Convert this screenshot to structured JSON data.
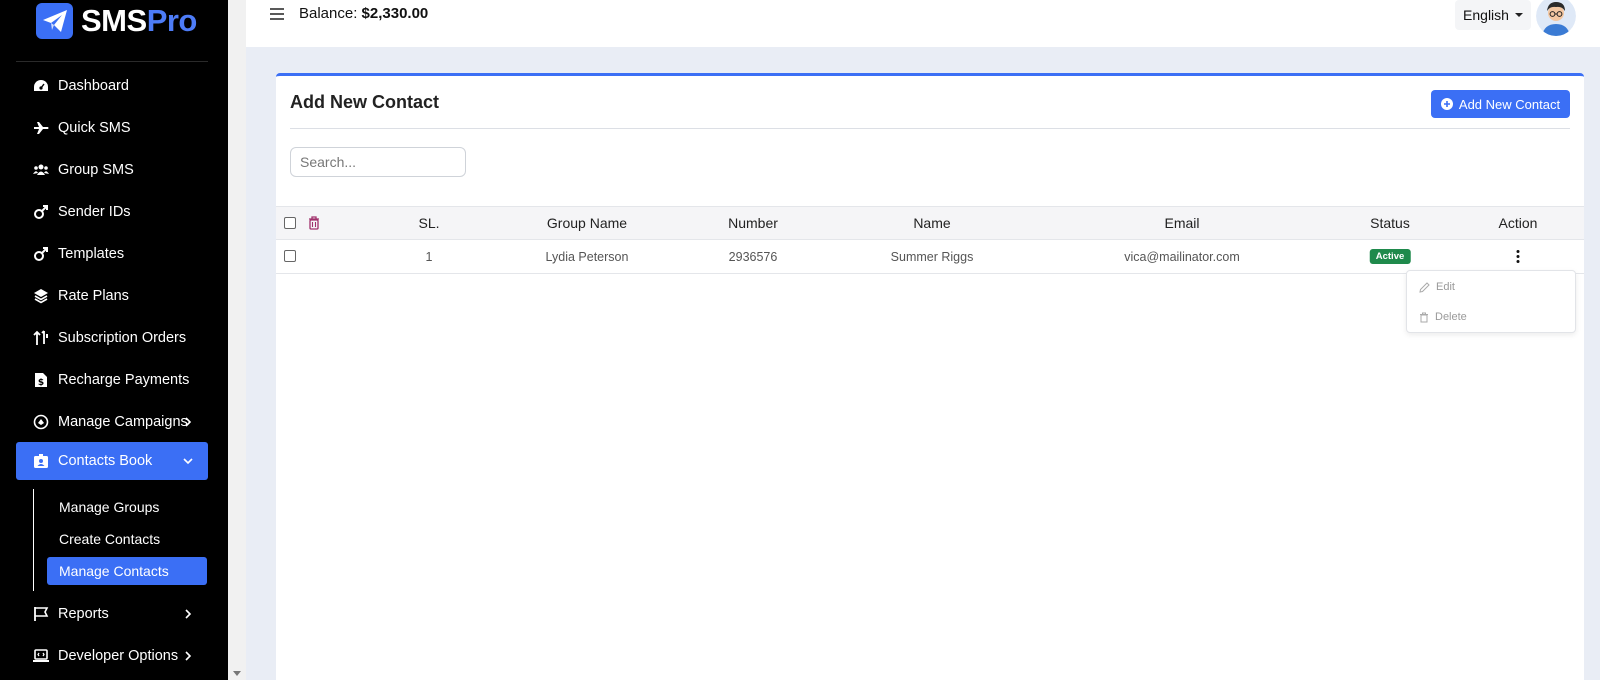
{
  "brand": {
    "name_part1": "SMS",
    "name_part2": "Pro"
  },
  "sidebar": {
    "items": [
      {
        "label": "Dashboard",
        "icon": "dashboard-gauge-icon"
      },
      {
        "label": "Quick SMS",
        "icon": "plane-icon"
      },
      {
        "label": "Group SMS",
        "icon": "users-icon"
      },
      {
        "label": "Sender IDs",
        "icon": "mars-icon"
      },
      {
        "label": "Templates",
        "icon": "mars-icon"
      },
      {
        "label": "Rate Plans",
        "icon": "layers-icon"
      },
      {
        "label": "Subscription Orders",
        "icon": "sort-arrows-icon"
      },
      {
        "label": "Recharge Payments",
        "icon": "invoice-dollar-icon"
      },
      {
        "label": "Manage Campaigns",
        "icon": "campaign-icon"
      },
      {
        "label": "Contacts Book",
        "icon": "contact-card-icon"
      },
      {
        "label": "Reports",
        "icon": "flag-icon"
      },
      {
        "label": "Developer Options",
        "icon": "laptop-code-icon"
      }
    ],
    "contacts_sub": [
      {
        "label": "Manage Groups"
      },
      {
        "label": "Create Contacts"
      },
      {
        "label": "Manage Contacts"
      }
    ]
  },
  "topbar": {
    "balance_label": "Balance:",
    "balance_value": "$2,330.00",
    "language": "English"
  },
  "page": {
    "title": "Add New Contact",
    "add_button": "Add New Contact",
    "search_placeholder": "Search..."
  },
  "table": {
    "headers": {
      "sl": "SL.",
      "group": "Group Name",
      "number": "Number",
      "name": "Name",
      "email": "Email",
      "status": "Status",
      "action": "Action"
    },
    "rows": [
      {
        "sl": "1",
        "group": "Lydia Peterson",
        "number": "2936576",
        "name": "Summer Riggs",
        "email": "vica@mailinator.com",
        "status": "Active"
      }
    ]
  },
  "action_menu": {
    "edit": "Edit",
    "delete": "Delete"
  },
  "colors": {
    "accent": "#3b6ff5",
    "active_badge": "#1f8a4c",
    "sidebar_bg": "#000000"
  }
}
